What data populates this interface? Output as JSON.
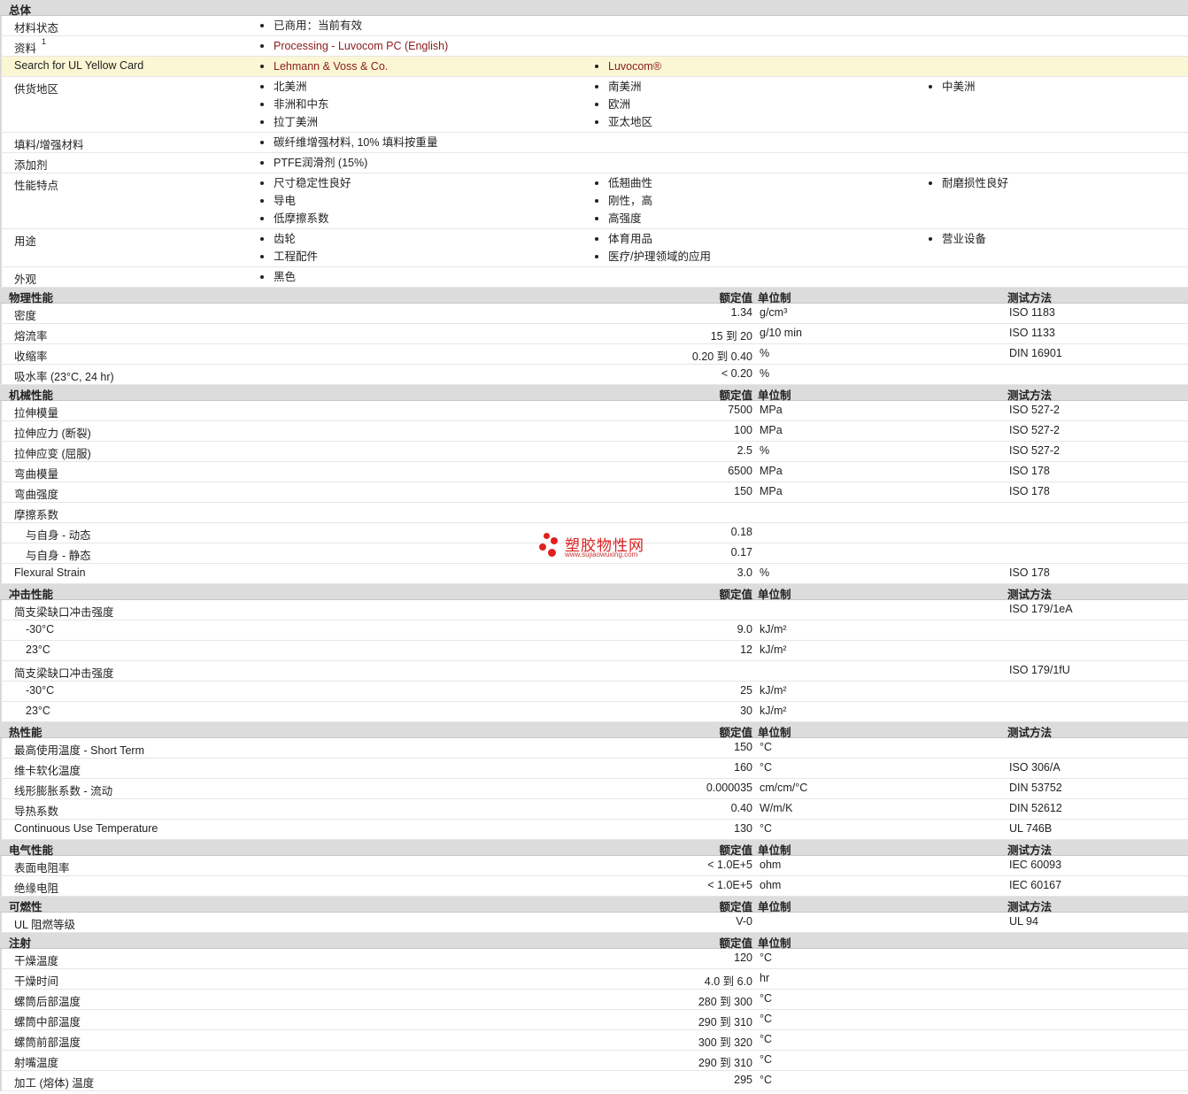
{
  "general": {
    "title": "总体",
    "rows": [
      {
        "label": "材料状态",
        "cols": [
          [
            "已商用：当前有效"
          ]
        ]
      },
      {
        "label": "资料",
        "sup": "1",
        "link": true,
        "cols": [
          [
            "Processing - Luvocom PC (English)"
          ]
        ]
      },
      {
        "label": "Search for UL Yellow Card",
        "link": true,
        "highlight": true,
        "cols": [
          [
            "Lehmann & Voss & Co."
          ],
          [
            "Luvocom®"
          ]
        ]
      },
      {
        "label": "供货地区",
        "cols": [
          [
            "北美洲",
            "非洲和中东",
            "拉丁美洲"
          ],
          [
            "南美洲",
            "欧洲",
            "亚太地区"
          ],
          [
            "中美洲"
          ]
        ]
      },
      {
        "label": "填料/增强材料",
        "cols": [
          [
            "碳纤维增强材料, 10% 填料按重量"
          ]
        ]
      },
      {
        "label": "添加剂",
        "cols": [
          [
            "PTFE润滑剂 (15%)"
          ]
        ]
      },
      {
        "label": "性能特点",
        "cols": [
          [
            "尺寸稳定性良好",
            "导电",
            "低摩擦系数"
          ],
          [
            "低翘曲性",
            "刚性，高",
            "高强度"
          ],
          [
            "耐磨损性良好"
          ]
        ]
      },
      {
        "label": "用途",
        "cols": [
          [
            "齿轮",
            "工程配件"
          ],
          [
            "体育用品",
            "医疗/护理领域的应用"
          ],
          [
            "营业设备"
          ]
        ]
      },
      {
        "label": "外观",
        "cols": [
          [
            "黑色"
          ]
        ]
      }
    ]
  },
  "headers": {
    "value": "额定值",
    "unit": "单位制",
    "method": "测试方法"
  },
  "sections": [
    {
      "title": "物理性能",
      "header": true,
      "rows": [
        {
          "label": "密度",
          "value": "1.34",
          "unit": "g/cm³",
          "method": "ISO 1183"
        },
        {
          "label": "熔流率",
          "value": "15 到  20",
          "unit": "g/10 min",
          "method": "ISO 1133"
        },
        {
          "label": "收缩率",
          "value": "0.20 到  0.40",
          "unit": "%",
          "method": "DIN 16901"
        },
        {
          "label": "吸水率 (23°C, 24 hr)",
          "value": "< 0.20",
          "unit": "%",
          "method": ""
        }
      ]
    },
    {
      "title": "机械性能",
      "header": true,
      "rows": [
        {
          "label": "拉伸模量",
          "value": "7500",
          "unit": "MPa",
          "method": "ISO 527-2"
        },
        {
          "label": "拉伸应力 (断裂)",
          "value": "100",
          "unit": "MPa",
          "method": "ISO 527-2"
        },
        {
          "label": "拉伸应变 (屈服)",
          "value": "2.5",
          "unit": "%",
          "method": "ISO 527-2"
        },
        {
          "label": "弯曲模量",
          "value": "6500",
          "unit": "MPa",
          "method": "ISO 178"
        },
        {
          "label": "弯曲强度",
          "value": "150",
          "unit": "MPa",
          "method": "ISO 178"
        },
        {
          "label": "摩擦系数",
          "value": "",
          "unit": "",
          "method": ""
        },
        {
          "label": "与自身  - 动态",
          "indent": true,
          "value": "0.18",
          "unit": "",
          "method": ""
        },
        {
          "label": "与自身  - 静态",
          "indent": true,
          "value": "0.17",
          "unit": "",
          "method": ""
        },
        {
          "label": "Flexural Strain",
          "value": "3.0",
          "unit": "%",
          "method": "ISO 178"
        }
      ]
    },
    {
      "title": "冲击性能",
      "header": true,
      "rows": [
        {
          "label": "简支梁缺口冲击强度",
          "value": "",
          "unit": "",
          "method": "ISO 179/1eA"
        },
        {
          "label": "-30°C",
          "indent": true,
          "value": "9.0",
          "unit": "kJ/m²",
          "method": ""
        },
        {
          "label": "23°C",
          "indent": true,
          "value": "12",
          "unit": "kJ/m²",
          "method": ""
        },
        {
          "label": "简支梁缺口冲击强度",
          "value": "",
          "unit": "",
          "method": "ISO 179/1fU"
        },
        {
          "label": "-30°C",
          "indent": true,
          "value": "25",
          "unit": "kJ/m²",
          "method": ""
        },
        {
          "label": "23°C",
          "indent": true,
          "value": "30",
          "unit": "kJ/m²",
          "method": ""
        }
      ]
    },
    {
      "title": "热性能",
      "header": true,
      "rows": [
        {
          "label": "最高使用温度  - Short Term",
          "value": "150",
          "unit": "°C",
          "method": ""
        },
        {
          "label": "维卡软化温度",
          "value": "160",
          "unit": "°C",
          "method": "ISO 306/A"
        },
        {
          "label": "线形膨胀系数  - 流动",
          "value": "0.000035",
          "unit": "cm/cm/°C",
          "method": "DIN 53752"
        },
        {
          "label": "导热系数",
          "value": "0.40",
          "unit": "W/m/K",
          "method": "DIN 52612"
        },
        {
          "label": "Continuous Use Temperature",
          "value": "130",
          "unit": "°C",
          "method": "UL 746B"
        }
      ]
    },
    {
      "title": "电气性能",
      "header": true,
      "rows": [
        {
          "label": "表面电阻率",
          "value": "< 1.0E+5",
          "unit": "ohm",
          "method": "IEC 60093"
        },
        {
          "label": "绝缘电阻",
          "value": "< 1.0E+5",
          "unit": "ohm",
          "method": "IEC 60167"
        }
      ]
    },
    {
      "title": "可燃性",
      "header": true,
      "rows": [
        {
          "label": "UL 阻燃等级",
          "value": "V-0",
          "unit": "",
          "method": "UL 94"
        }
      ]
    },
    {
      "title": "注射",
      "header": true,
      "noMethod": true,
      "rows": [
        {
          "label": "干燥温度",
          "value": "120",
          "unit": "°C",
          "method": ""
        },
        {
          "label": "干燥时间",
          "value": "4.0 到  6.0",
          "unit": "hr",
          "method": ""
        },
        {
          "label": "螺筒后部温度",
          "value": "280 到  300",
          "unit": "°C",
          "method": ""
        },
        {
          "label": "螺筒中部温度",
          "value": "290 到  310",
          "unit": "°C",
          "method": ""
        },
        {
          "label": "螺筒前部温度",
          "value": "300 到  320",
          "unit": "°C",
          "method": ""
        },
        {
          "label": "射嘴温度",
          "value": "290 到  310",
          "unit": "°C",
          "method": ""
        },
        {
          "label": "加工 (熔体) 温度",
          "value": "295",
          "unit": "°C",
          "method": ""
        }
      ]
    }
  ],
  "watermark": {
    "text": "塑胶物性网",
    "url": "www.sujiaowuxing.com"
  }
}
